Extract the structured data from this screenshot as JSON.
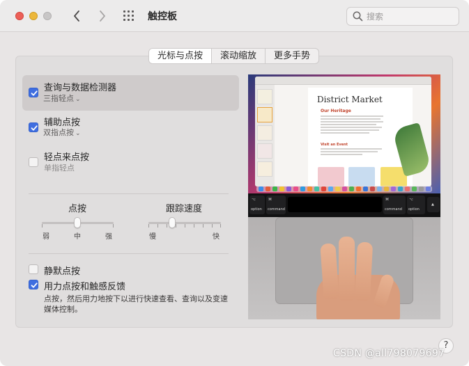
{
  "window": {
    "title": "触控板"
  },
  "search": {
    "placeholder": "搜索"
  },
  "tabs": [
    {
      "label": "光标与点按",
      "active": true
    },
    {
      "label": "滚动缩放",
      "active": false
    },
    {
      "label": "更多手势",
      "active": false
    }
  ],
  "options": [
    {
      "label": "查询与数据检测器",
      "sub": "三指轻点",
      "checked": true,
      "has_menu": true,
      "highlighted": true
    },
    {
      "label": "辅助点按",
      "sub": "双指点按",
      "checked": true,
      "has_menu": true
    },
    {
      "label": "轻点来点按",
      "sub": "单指轻点",
      "checked": false,
      "has_menu": false
    }
  ],
  "sliders": {
    "click": {
      "title": "点按",
      "labels": [
        "弱",
        "中",
        "强"
      ],
      "value": "中"
    },
    "tracking": {
      "title": "跟踪速度",
      "min_label": "慢",
      "max_label": "快",
      "level": 0.33
    }
  },
  "silent_click": {
    "label": "静默点按",
    "checked": false
  },
  "force_click": {
    "label": "用力点按和触感反馈",
    "checked": true,
    "description": "点按，然后用力地按下以进行快速查看、查询以及变速媒体控制。"
  },
  "preview": {
    "doc_title": "District Market",
    "section_1": "Our Heritage",
    "section_2": "Visit an Event",
    "keys": {
      "left_option": "option",
      "left_command": "command",
      "right_command": "command",
      "right_option": "option"
    }
  },
  "help": {
    "label": "?"
  },
  "watermark": "CSDN @all798079697",
  "colors": {
    "accent": "#3f6ee0",
    "close": "#ec5f57",
    "minimize": "#ecb73b"
  }
}
